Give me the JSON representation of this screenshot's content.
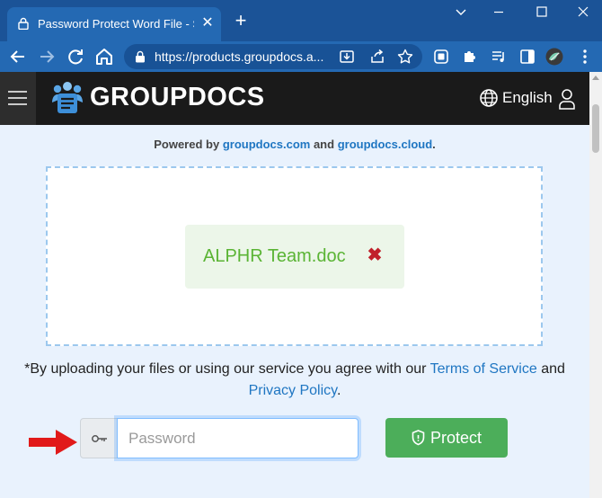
{
  "browser": {
    "tab_title": "Password Protect Word File - Safe",
    "new_tab_symbol": "+",
    "close_tab_symbol": "✕",
    "url": "https://products.groupdocs.a...",
    "accent_color": "#2469b3"
  },
  "site": {
    "logo_text": "GROUPDOCS",
    "language": "English"
  },
  "powered": {
    "prefix": "Powered by",
    "link1": "groupdocs.com",
    "middle": "and",
    "link2": "groupdocs.cloud",
    "suffix": "."
  },
  "upload": {
    "file_name": "ALPHR Team.doc",
    "remove_symbol": "✖",
    "file_color": "#5ab434"
  },
  "terms": {
    "prefix": "*By uploading your files or using our service you agree with our",
    "terms_link": "Terms of Service",
    "middle": "and",
    "privacy_link": "Privacy Policy",
    "suffix": "."
  },
  "form": {
    "password_placeholder": "Password",
    "password_value": "",
    "protect_label": "Protect",
    "protect_color": "#4cae5a"
  },
  "icons": {
    "tab": "lock-icon",
    "addon": "key-icon",
    "protect": "shield-icon",
    "annotation": "red-arrow"
  }
}
